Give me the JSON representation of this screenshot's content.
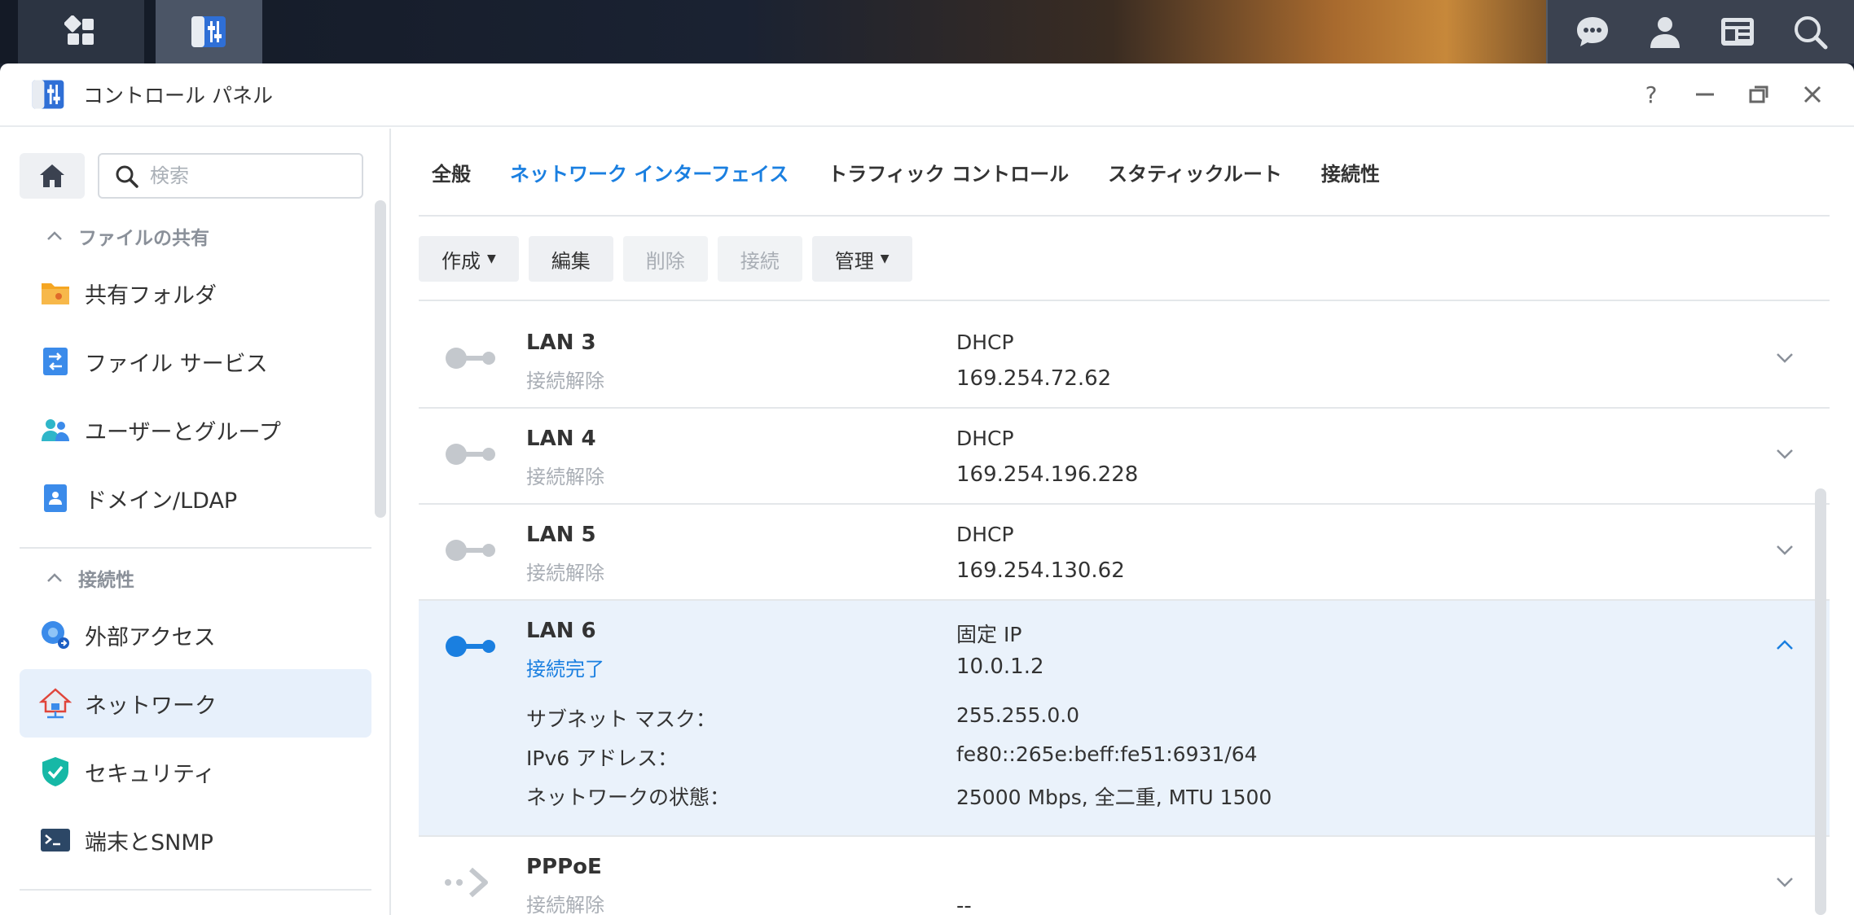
{
  "window": {
    "title": "コントロール パネル",
    "controls": [
      "?",
      "—",
      "❐",
      "✕"
    ]
  },
  "sidebar": {
    "search_placeholder": "検索",
    "sections": [
      {
        "title": "ファイルの共有",
        "items": [
          "共有フォルダ",
          "ファイル サービス",
          "ユーザーとグループ",
          "ドメイン/LDAP"
        ]
      },
      {
        "title": "接続性",
        "items": [
          "外部アクセス",
          "ネットワーク",
          "セキュリティ",
          "端末とSNMP"
        ]
      }
    ],
    "active_item": "ネットワーク"
  },
  "tabs": [
    "全般",
    "ネットワーク インターフェイス",
    "トラフィック コントロール",
    "スタティックルート",
    "接続性"
  ],
  "active_tab": "ネットワーク インターフェイス",
  "toolbar": {
    "create": "作成",
    "edit": "編集",
    "delete": "削除",
    "connect": "接続",
    "manage": "管理"
  },
  "interfaces": [
    {
      "name": "LAN 3",
      "status": "接続解除",
      "mode": "DHCP",
      "ip": "169.254.72.62"
    },
    {
      "name": "LAN 4",
      "status": "接続解除",
      "mode": "DHCP",
      "ip": "169.254.196.228"
    },
    {
      "name": "LAN 5",
      "status": "接続解除",
      "mode": "DHCP",
      "ip": "169.254.130.62"
    },
    {
      "name": "LAN 6",
      "status": "接続完了",
      "mode": "固定 IP",
      "ip": "10.0.1.2",
      "details": [
        {
          "label": "サブネット マスク：",
          "value": "255.255.0.0"
        },
        {
          "label": "IPv6 アドレス：",
          "value": "fe80::265e:beff:fe51:6931/64"
        },
        {
          "label": "ネットワークの状態：",
          "value": "25000 Mbps, 全二重, MTU 1500"
        }
      ]
    },
    {
      "name": "PPPoE",
      "status": "接続解除",
      "mode": "",
      "ip": "--"
    }
  ],
  "colors": {
    "accent": "#1a7fe0",
    "inactive": "#c4c8cd",
    "selected_row": "#eaf2fb"
  }
}
